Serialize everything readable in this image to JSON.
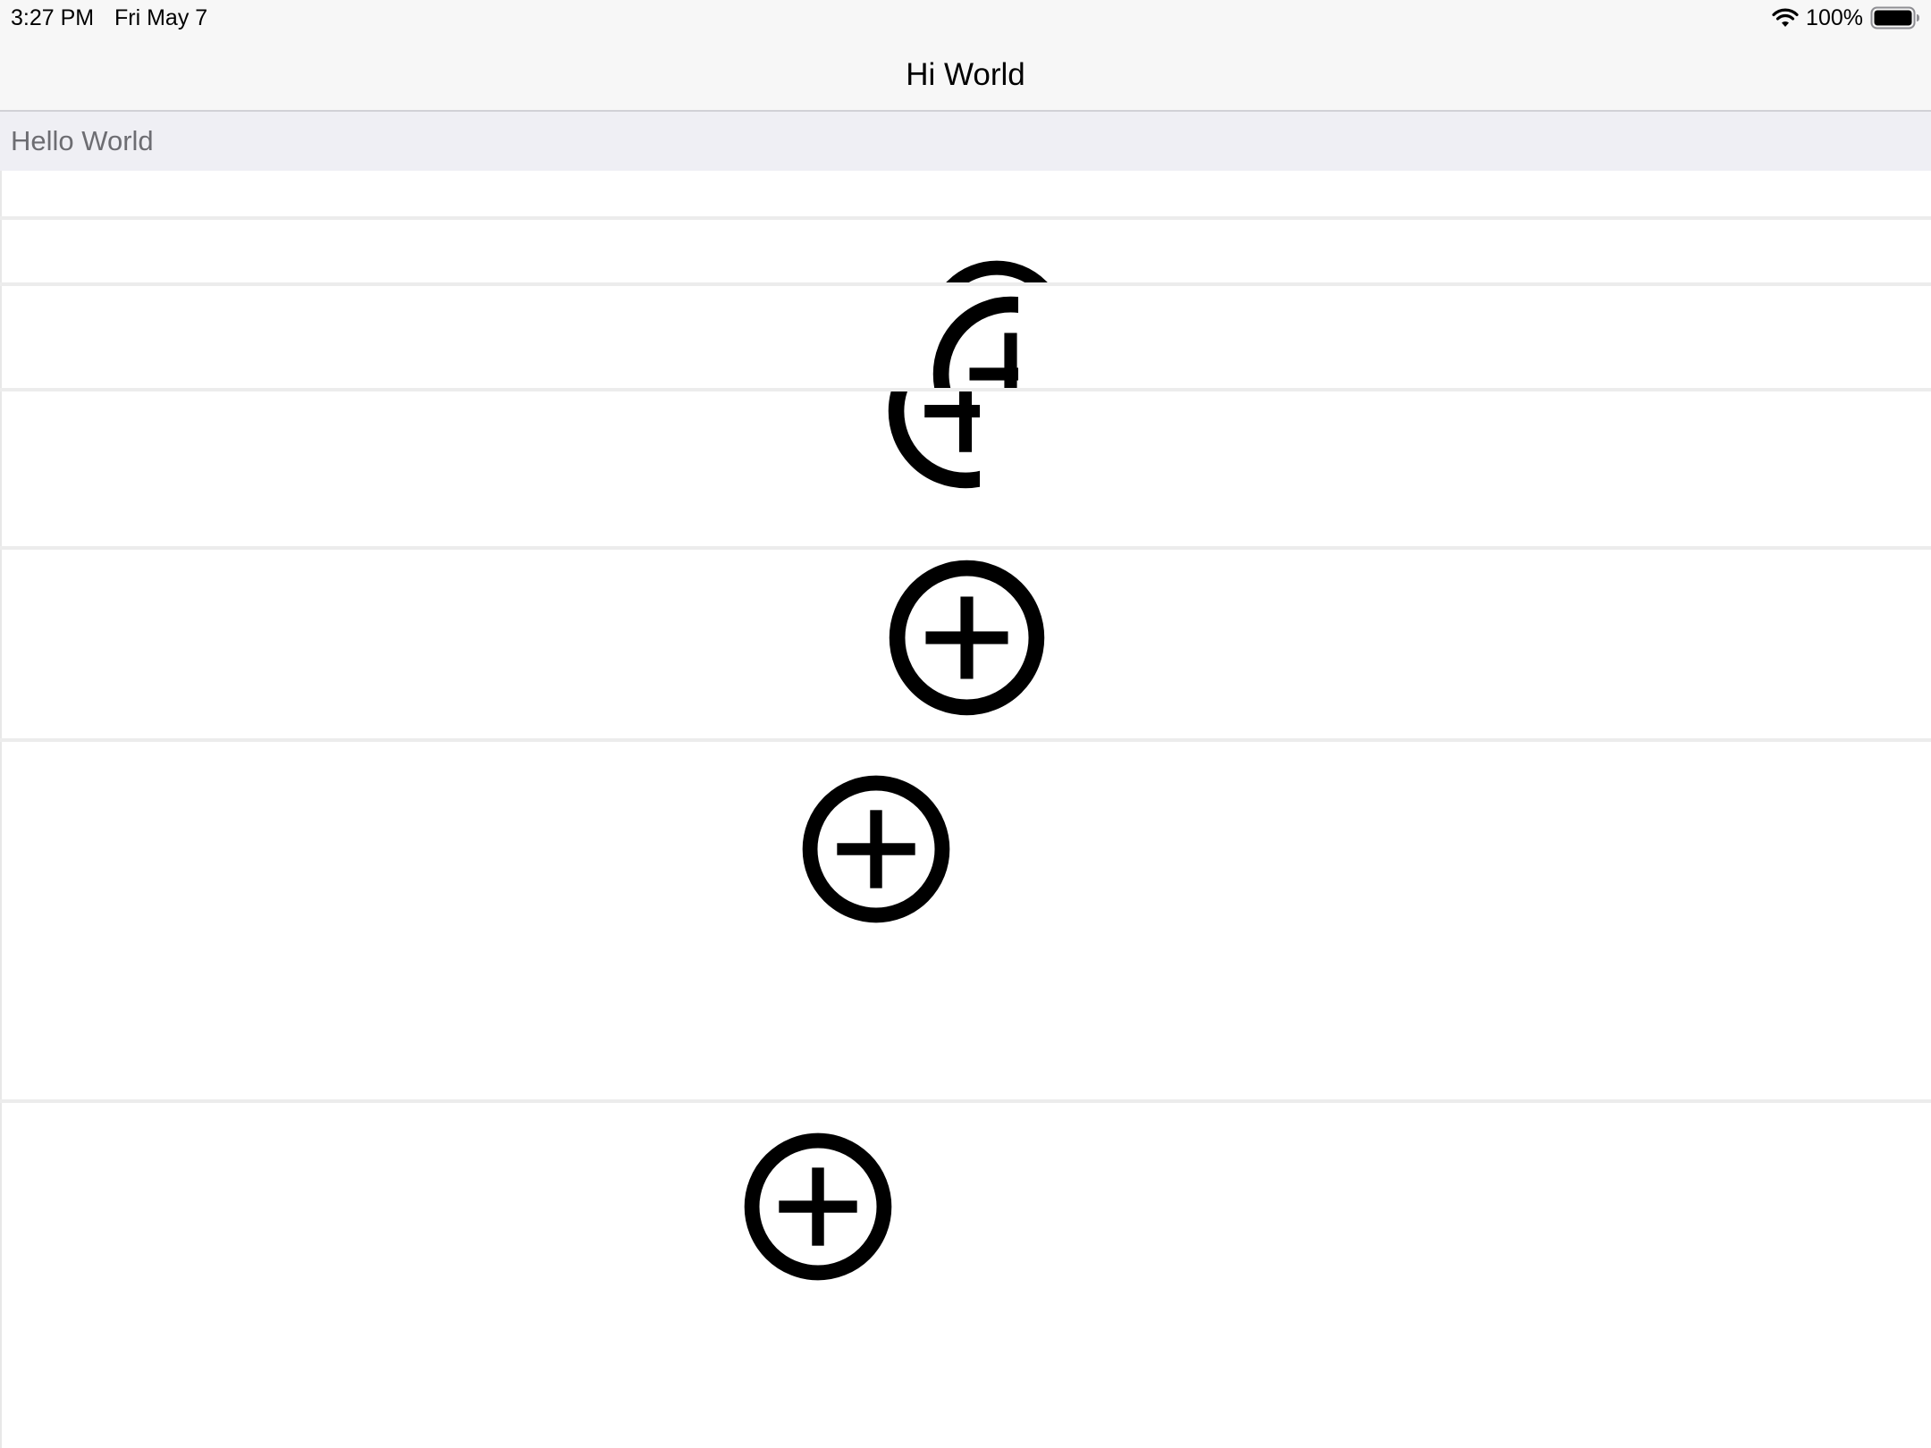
{
  "status_bar": {
    "time": "3:27 PM",
    "date": "Fri May 7",
    "battery_percent": "100%",
    "icons": [
      "wifi-icon",
      "battery-icon"
    ]
  },
  "nav_bar": {
    "title": "Hi World"
  },
  "section": {
    "header": "Hello World"
  },
  "rows": [
    {
      "icon": null
    },
    {
      "icon": "plus-circle-icon"
    },
    {
      "icon": "plus-circle-icon"
    },
    {
      "icon": "plus-circle-icon"
    },
    {
      "icon": "plus-circle-icon"
    },
    {
      "icon": "plus-circle-icon"
    },
    {
      "icon": "plus-circle-icon"
    }
  ],
  "colors": {
    "bar_background": "#f7f7f7",
    "section_background": "#efeff4",
    "section_text": "#6d6d72",
    "separator": "#ececec",
    "icon": "#000000"
  }
}
